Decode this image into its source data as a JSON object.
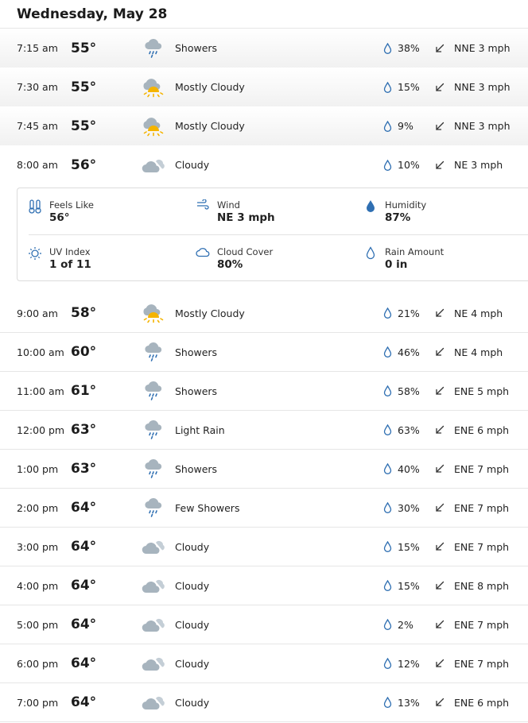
{
  "header": {
    "title": "Wednesday, May 28"
  },
  "hours_past": [
    {
      "time": "7:15 am",
      "temp": "55°",
      "icon": "showers-icon",
      "condition": "Showers",
      "precip": "38%",
      "wind_dir_icon": "arrow-down-left-icon",
      "wind": "NNE 3 mph"
    },
    {
      "time": "7:30 am",
      "temp": "55°",
      "icon": "mostly-cloudy-icon",
      "condition": "Mostly Cloudy",
      "precip": "15%",
      "wind_dir_icon": "arrow-down-left-icon",
      "wind": "NNE 3 mph"
    },
    {
      "time": "7:45 am",
      "temp": "55°",
      "icon": "mostly-cloudy-icon",
      "condition": "Mostly Cloudy",
      "precip": "9%",
      "wind_dir_icon": "arrow-down-left-icon",
      "wind": "NNE 3 mph"
    }
  ],
  "current": {
    "time": "8:00 am",
    "temp": "56°",
    "icon": "cloudy-icon",
    "condition": "Cloudy",
    "precip": "10%",
    "wind_dir_icon": "arrow-down-left-icon",
    "wind": "NE 3 mph"
  },
  "details": {
    "feels_like": {
      "label": "Feels Like",
      "value": "56°"
    },
    "wind": {
      "label": "Wind",
      "value": "NE 3 mph"
    },
    "humidity": {
      "label": "Humidity",
      "value": "87%"
    },
    "uv_index": {
      "label": "UV Index",
      "value": "1 of 11"
    },
    "cloud_cover": {
      "label": "Cloud Cover",
      "value": "80%"
    },
    "rain_amount": {
      "label": "Rain Amount",
      "value": "0 in"
    }
  },
  "hours": [
    {
      "time": "9:00 am",
      "temp": "58°",
      "icon": "mostly-cloudy-icon",
      "condition": "Mostly Cloudy",
      "precip": "21%",
      "wind": "NE 4 mph"
    },
    {
      "time": "10:00 am",
      "temp": "60°",
      "icon": "showers-icon",
      "condition": "Showers",
      "precip": "46%",
      "wind": "NE 4 mph"
    },
    {
      "time": "11:00 am",
      "temp": "61°",
      "icon": "showers-icon",
      "condition": "Showers",
      "precip": "58%",
      "wind": "ENE 5 mph"
    },
    {
      "time": "12:00 pm",
      "temp": "63°",
      "icon": "showers-icon",
      "condition": "Light Rain",
      "precip": "63%",
      "wind": "ENE 6 mph"
    },
    {
      "time": "1:00 pm",
      "temp": "63°",
      "icon": "showers-icon",
      "condition": "Showers",
      "precip": "40%",
      "wind": "ENE 7 mph"
    },
    {
      "time": "2:00 pm",
      "temp": "64°",
      "icon": "showers-icon",
      "condition": "Few Showers",
      "precip": "30%",
      "wind": "ENE 7 mph"
    },
    {
      "time": "3:00 pm",
      "temp": "64°",
      "icon": "cloudy-icon",
      "condition": "Cloudy",
      "precip": "15%",
      "wind": "ENE 7 mph"
    },
    {
      "time": "4:00 pm",
      "temp": "64°",
      "icon": "cloudy-icon",
      "condition": "Cloudy",
      "precip": "15%",
      "wind": "ENE 8 mph"
    },
    {
      "time": "5:00 pm",
      "temp": "64°",
      "icon": "cloudy-icon",
      "condition": "Cloudy",
      "precip": "2%",
      "wind": "ENE 7 mph"
    },
    {
      "time": "6:00 pm",
      "temp": "64°",
      "icon": "cloudy-icon",
      "condition": "Cloudy",
      "precip": "12%",
      "wind": "ENE 7 mph"
    },
    {
      "time": "7:00 pm",
      "temp": "64°",
      "icon": "cloudy-icon",
      "condition": "Cloudy",
      "precip": "13%",
      "wind": "ENE 6 mph"
    }
  ],
  "colors": {
    "cloud": "#aab7c1",
    "sun": "#f5b400",
    "rain": "#2f6fb2",
    "accent": "#2f6fb2"
  }
}
